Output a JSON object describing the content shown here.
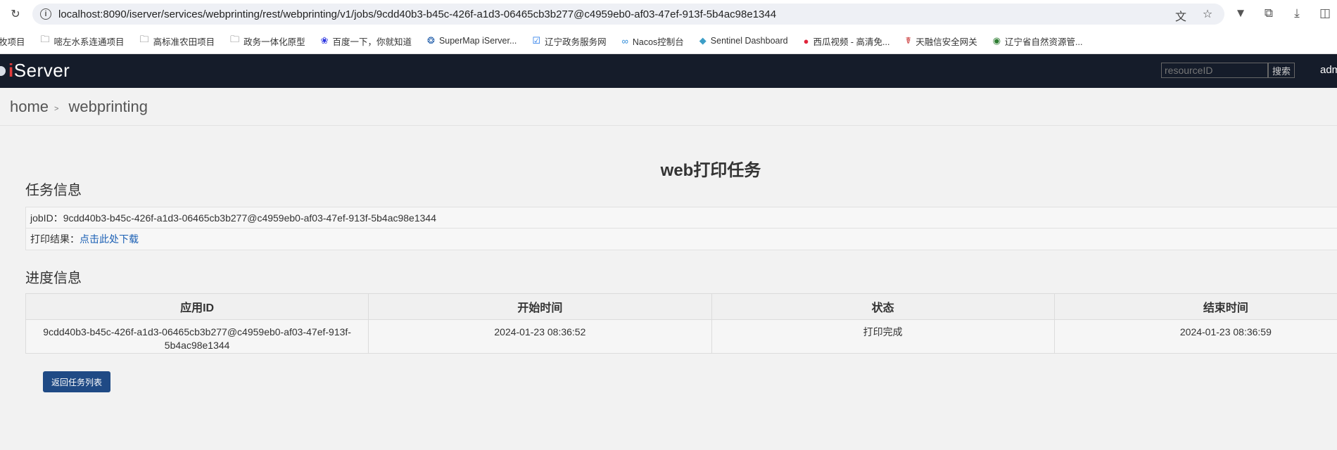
{
  "browser": {
    "url": "localhost:8090/iserver/services/webprinting/rest/webprinting/v1/jobs/9cdd40b3-b45c-426f-a1d3-06465cb3b277@c4959eb0-af03-47ef-913f-5b4ac98e1344",
    "bookmarks": [
      {
        "label": "牧项目",
        "icon": "folder-icon"
      },
      {
        "label": "嘧左水系连通项目",
        "icon": "folder-icon"
      },
      {
        "label": "高标准农田项目",
        "icon": "folder-icon"
      },
      {
        "label": "政务一体化原型",
        "icon": "folder-icon"
      },
      {
        "label": "百度一下，你就知道",
        "icon": "baidu-icon"
      },
      {
        "label": "SuperMap iServer...",
        "icon": "supermap-icon"
      },
      {
        "label": "辽宁政务服务网",
        "icon": "shield-icon"
      },
      {
        "label": "Nacos控制台",
        "icon": "infinity-icon"
      },
      {
        "label": "Sentinel Dashboard",
        "icon": "sentinel-icon"
      },
      {
        "label": "西瓜视频 - 高清免...",
        "icon": "video-icon"
      },
      {
        "label": "天融信安全网关",
        "icon": "gateway-icon"
      },
      {
        "label": "辽宁省自然资源管...",
        "icon": "seal-icon"
      }
    ]
  },
  "header": {
    "logo": "iServer",
    "search_placeholder": "resourceID",
    "search_button": "搜索",
    "user": "admin"
  },
  "breadcrumb": {
    "home": "home",
    "current": "webprinting"
  },
  "page": {
    "title": "web打印任务",
    "task_section": "任务信息",
    "job_label": "jobID：",
    "job_id": "9cdd40b3-b45c-426f-a1d3-06465cb3b277@c4959eb0-af03-47ef-913f-5b4ac98e1344",
    "result_label": "打印结果：",
    "result_link": "点击此处下载",
    "progress_section": "进度信息",
    "table": {
      "headers": [
        "应用ID",
        "开始时间",
        "状态",
        "结束时间"
      ],
      "rows": [
        [
          "9cdd40b3-b45c-426f-a1d3-06465cb3b277@c4959eb0-af03-47ef-913f-5b4ac98e1344",
          "2024-01-23 08:36:52",
          "打印完成",
          "2024-01-23 08:36:59"
        ]
      ]
    },
    "back_button": "返回任务列表"
  }
}
